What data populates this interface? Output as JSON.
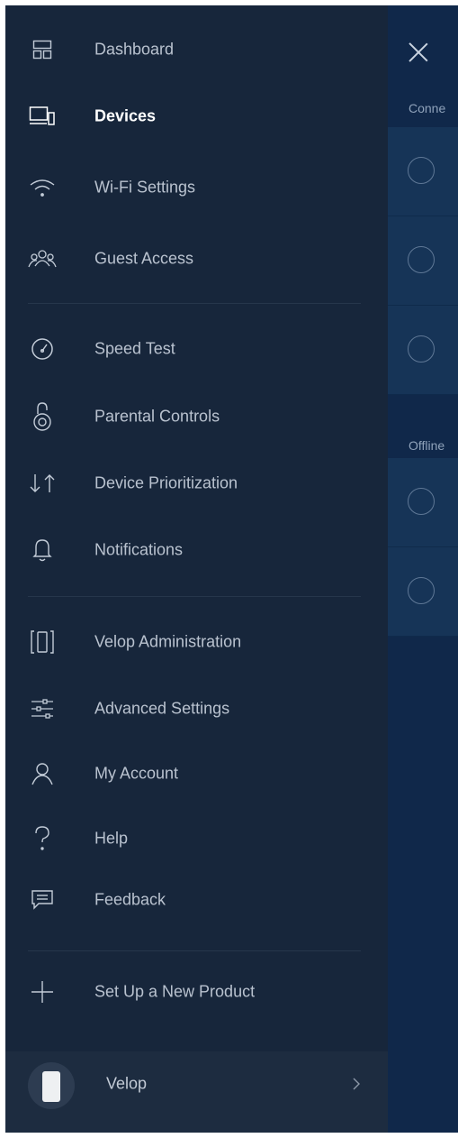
{
  "right_panel": {
    "section_connected": "Conne",
    "section_offline": "Offline",
    "connected_count": 3,
    "offline_count": 2
  },
  "menu": {
    "items": [
      {
        "label": "Dashboard",
        "icon": "dashboard-icon"
      },
      {
        "label": "Devices",
        "icon": "devices-icon",
        "active": true
      },
      {
        "label": "Wi-Fi Settings",
        "icon": "wifi-icon"
      },
      {
        "label": "Guest Access",
        "icon": "guest-access-icon"
      },
      {
        "label": "Speed Test",
        "icon": "speedometer-icon"
      },
      {
        "label": "Parental Controls",
        "icon": "lock-icon"
      },
      {
        "label": "Device Prioritization",
        "icon": "priority-arrows-icon"
      },
      {
        "label": "Notifications",
        "icon": "bell-icon"
      },
      {
        "label": "Velop Administration",
        "icon": "velop-node-icon"
      },
      {
        "label": "Advanced Settings",
        "icon": "sliders-icon"
      },
      {
        "label": "My Account",
        "icon": "user-icon"
      },
      {
        "label": "Help",
        "icon": "help-icon"
      },
      {
        "label": "Feedback",
        "icon": "feedback-icon"
      },
      {
        "label": "Set Up a New Product",
        "icon": "plus-icon"
      }
    ]
  },
  "footer": {
    "label": "Velop",
    "icon": "velop-avatar-icon"
  },
  "colors": {
    "drawer_bg": "#17263b",
    "panel_bg": "#10284a",
    "active_text": "#ffffff",
    "text": "#b9c2cf"
  }
}
